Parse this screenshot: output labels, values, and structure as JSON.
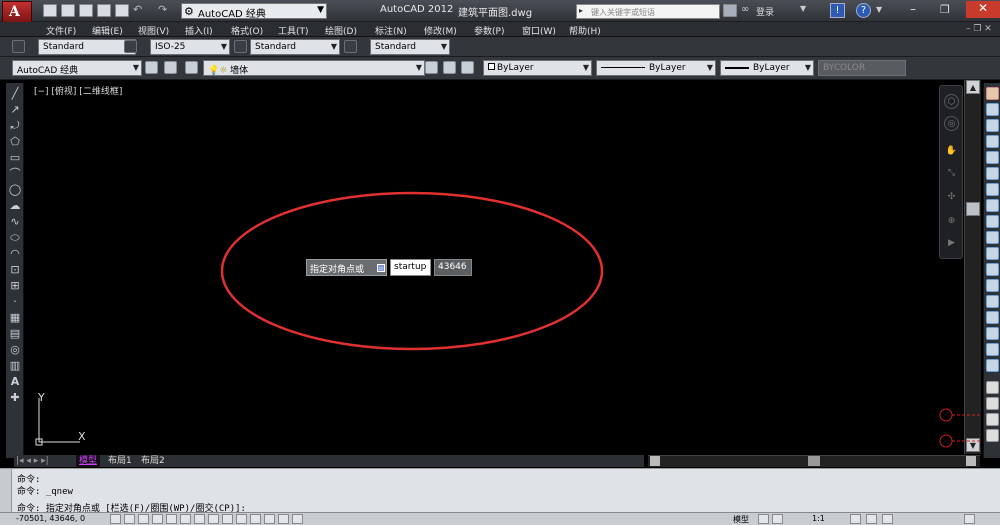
{
  "app": {
    "title": "AutoCAD 2012",
    "file": "建筑平面图.dwg",
    "logo": "A",
    "workspace": "AutoCAD 经典",
    "search_placeholder": "键入关键字或短语",
    "login": "登录"
  },
  "menu": [
    "文件(F)",
    "编辑(E)",
    "视图(V)",
    "插入(I)",
    "格式(O)",
    "工具(T)",
    "绘图(D)",
    "标注(N)",
    "修改(M)",
    "参数(P)",
    "窗口(W)",
    "帮助(H)"
  ],
  "styles_toolbar": {
    "text_style": "Standard",
    "dim_style": "ISO-25",
    "table_style": "Standard",
    "multileader_style": "Standard"
  },
  "layers_toolbar": {
    "workspace": "AutoCAD 经典",
    "layer": "墙体",
    "color": "ByLayer",
    "linetype": "ByLayer",
    "lineweight": "ByLayer",
    "plotstyle": "BYCOLOR"
  },
  "viewport": {
    "label": "[−] [俯视] [二维线框]",
    "ucs_y": "Y",
    "ucs_x": "X"
  },
  "dynamic_input": {
    "prompt": "指定对角点或",
    "prompt_marker": "▫",
    "input_value": "startup",
    "coordinate": "43646"
  },
  "tabs": {
    "model": "模型",
    "layout1": "布局1",
    "layout2": "布局2"
  },
  "command_line": {
    "line1": "命令:",
    "line2": "命令: _qnew",
    "line3": "命令: 指定对角点或 [栏选(F)/圈围(WP)/圈交(CP)]:"
  },
  "status_bar": {
    "coords": "-70501, 43646, 0",
    "model_label": "模型",
    "scale": "1:1"
  },
  "colors": {
    "canvas": "#000000",
    "annotation": "#e03030",
    "ui_dark": "#2e3136",
    "command_bg": "#dfe3e7"
  }
}
